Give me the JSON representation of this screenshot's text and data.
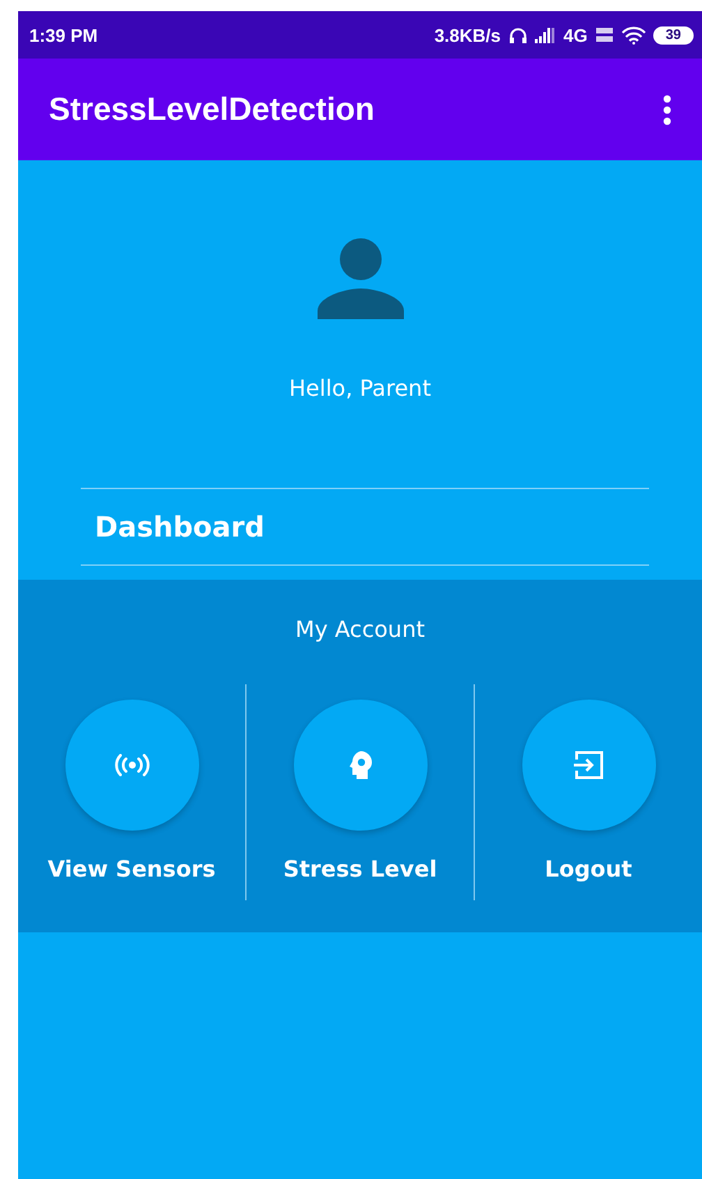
{
  "status_bar": {
    "time": "1:39 PM",
    "speed": "3.8KB/s",
    "network": "4G",
    "battery": "39"
  },
  "app_bar": {
    "title": "StressLevelDetection"
  },
  "profile": {
    "greeting": "Hello, Parent"
  },
  "dashboard": {
    "title": "Dashboard"
  },
  "account": {
    "title": "My Account",
    "actions": [
      {
        "kind": "sensors",
        "label": "View Sensors"
      },
      {
        "kind": "stress",
        "label": "Stress Level"
      },
      {
        "kind": "logout",
        "label": "Logout"
      }
    ]
  }
}
